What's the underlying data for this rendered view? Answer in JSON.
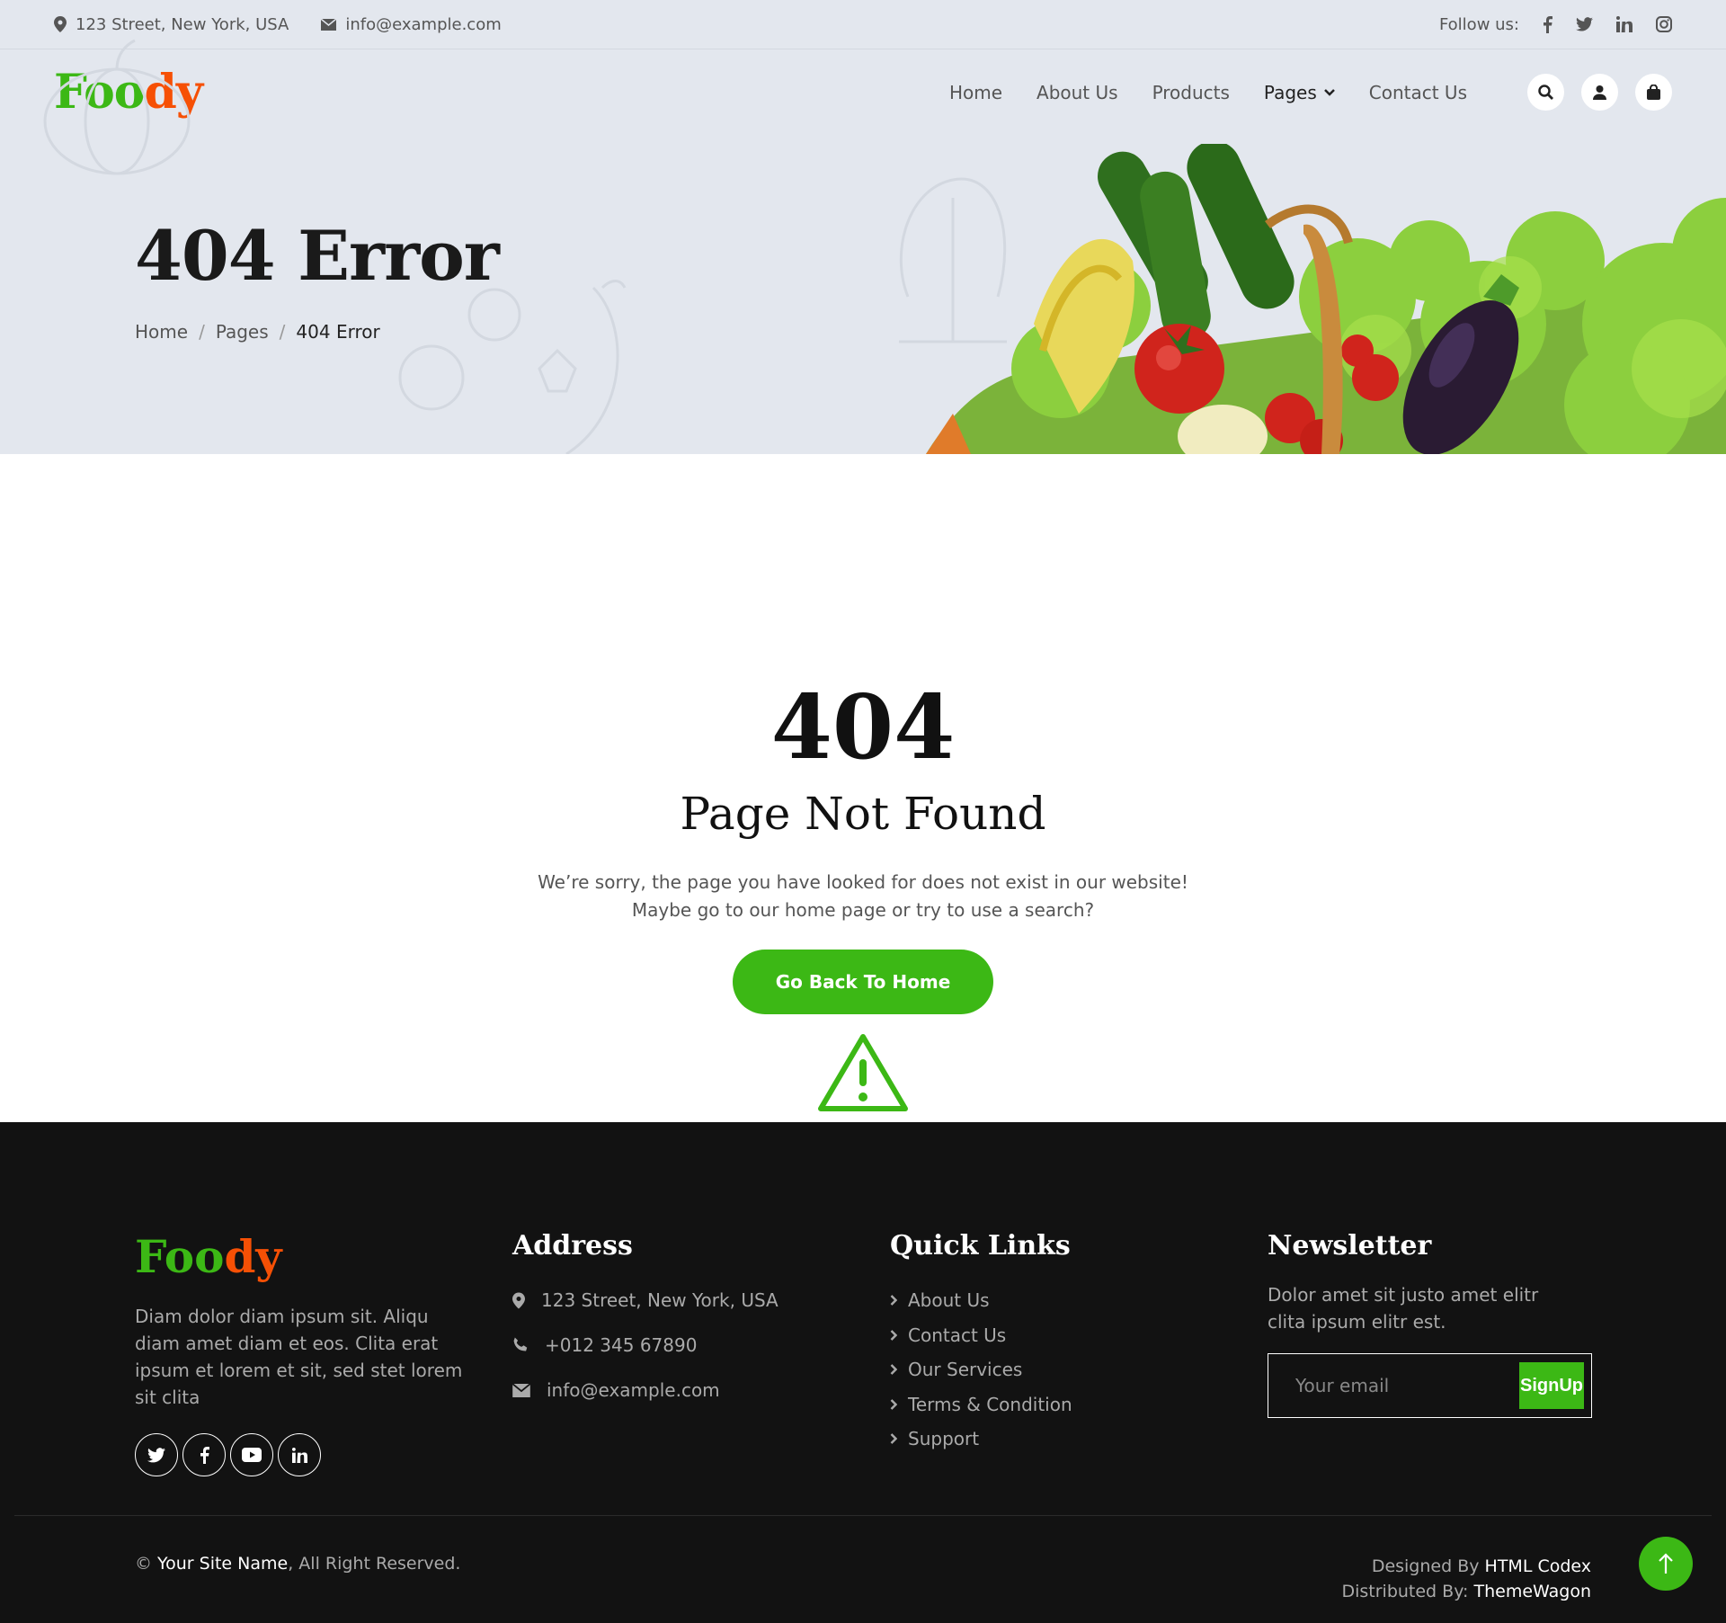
{
  "topbar": {
    "address": "123 Street, New York, USA",
    "email": "info@example.com",
    "follow_label": "Follow us:",
    "socials": [
      "facebook-icon",
      "twitter-icon",
      "linkedin-icon",
      "instagram-icon"
    ]
  },
  "brand": {
    "part1": "Foo",
    "part2": "dy",
    "green": "#3cb815",
    "orange": "#f65005"
  },
  "nav": {
    "items": [
      "Home",
      "About Us",
      "Products",
      "Pages",
      "Contact Us"
    ],
    "active": "Pages",
    "icons": [
      "search-icon",
      "user-icon",
      "bag-icon"
    ]
  },
  "hero": {
    "title": "404 Error",
    "breadcrumb": [
      "Home",
      "Pages",
      "404 Error"
    ],
    "separator": "/"
  },
  "error": {
    "code": "404",
    "heading": "Page Not Found",
    "message": "We’re sorry, the page you have looked for does not exist in our website! Maybe go to our home page or try to use a search?",
    "button": "Go Back To Home"
  },
  "footer": {
    "description": "Diam dolor diam ipsum sit. Aliqu diam amet diam et eos. Clita erat ipsum et lorem et sit, sed stet lorem sit clita",
    "socials": [
      "twitter-icon",
      "facebook-icon",
      "youtube-icon",
      "linkedin-icon"
    ],
    "address_heading": "Address",
    "address": "123 Street, New York, USA",
    "phone": "+012 345 67890",
    "email": "info@example.com",
    "quick_links_heading": "Quick Links",
    "quick_links": [
      "About Us",
      "Contact Us",
      "Our Services",
      "Terms & Condition",
      "Support"
    ],
    "newsletter_heading": "Newsletter",
    "newsletter_text": "Dolor amet sit justo amet elitr clita ipsum elitr est.",
    "email_placeholder": "Your email",
    "signup": "SignUp",
    "copyright_symbol": "©",
    "site_name": "Your Site Name",
    "rights": ", All Right Reserved.",
    "designed_by_label": "Designed By",
    "designed_by": "HTML Codex",
    "distributed_by_label": "Distributed By:",
    "distributed_by": "ThemeWagon"
  },
  "colors": {
    "accent": "#3cb815",
    "footer_bg": "#121212",
    "hero_bg": "#e3e7ee"
  }
}
